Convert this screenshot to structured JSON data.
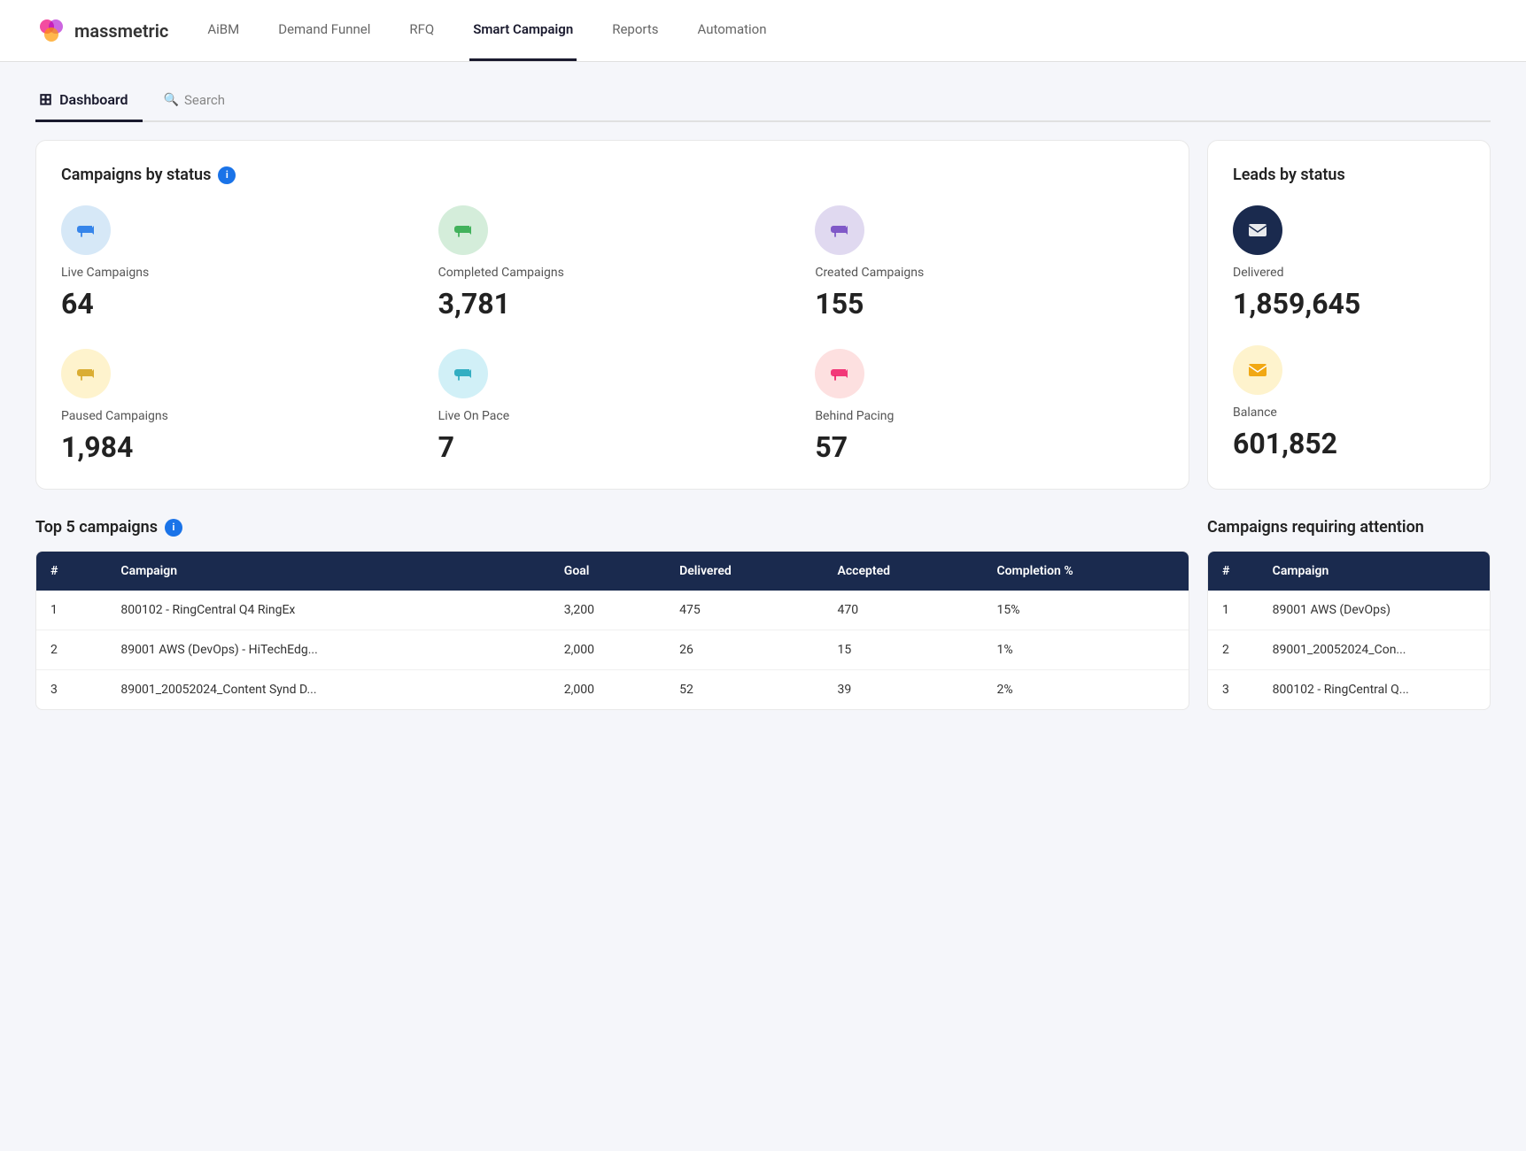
{
  "app": {
    "name": "massmetric"
  },
  "nav": {
    "items": [
      {
        "id": "aibm",
        "label": "AiBM",
        "active": false
      },
      {
        "id": "demand-funnel",
        "label": "Demand Funnel",
        "active": false
      },
      {
        "id": "rfq",
        "label": "RFQ",
        "active": false
      },
      {
        "id": "smart-campaign",
        "label": "Smart Campaign",
        "active": true
      },
      {
        "id": "reports",
        "label": "Reports",
        "active": false
      },
      {
        "id": "automation",
        "label": "Automation",
        "active": false
      }
    ]
  },
  "tabs": {
    "dashboard_label": "Dashboard",
    "search_label": "Search"
  },
  "campaigns_by_status": {
    "title": "Campaigns by status",
    "items": [
      {
        "id": "live-campaigns",
        "label": "Live Campaigns",
        "value": "64",
        "icon": "📣",
        "icon_class": "icon-blue-light"
      },
      {
        "id": "completed-campaigns",
        "label": "Completed Campaigns",
        "value": "3,781",
        "icon": "📣",
        "icon_class": "icon-green-light"
      },
      {
        "id": "created-campaigns",
        "label": "Created Campaigns",
        "value": "155",
        "icon": "📣",
        "icon_class": "icon-purple-light"
      },
      {
        "id": "paused-campaigns",
        "label": "Paused Campaigns",
        "value": "1,984",
        "icon": "📣",
        "icon_class": "icon-yellow-light"
      },
      {
        "id": "live-on-pace",
        "label": "Live On Pace",
        "value": "7",
        "icon": "📣",
        "icon_class": "icon-cyan-light"
      },
      {
        "id": "behind-pacing",
        "label": "Behind Pacing",
        "value": "57",
        "icon": "📣",
        "icon_class": "icon-pink-light"
      }
    ]
  },
  "leads_by_status": {
    "title": "Leads by status",
    "items": [
      {
        "id": "delivered",
        "label": "Delivered",
        "value": "1,859,645",
        "icon": "✉",
        "icon_class": "icon-dark-blue"
      },
      {
        "id": "balance",
        "label": "Balance",
        "value": "601,852",
        "icon": "✉",
        "icon_class": "icon-gold"
      }
    ]
  },
  "top5_campaigns": {
    "title": "Top 5 campaigns",
    "table": {
      "headers": [
        "#",
        "Campaign",
        "Goal",
        "Delivered",
        "Accepted",
        "Completion %"
      ],
      "rows": [
        {
          "num": "1",
          "campaign": "800102 - RingCentral Q4 RingEx",
          "goal": "3,200",
          "delivered": "475",
          "accepted": "470",
          "completion": "15%"
        },
        {
          "num": "2",
          "campaign": "89001 AWS (DevOps) - HiTechEdg...",
          "goal": "2,000",
          "delivered": "26",
          "accepted": "15",
          "completion": "1%"
        },
        {
          "num": "3",
          "campaign": "89001_20052024_Content Synd D...",
          "goal": "2,000",
          "delivered": "52",
          "accepted": "39",
          "completion": "2%"
        }
      ]
    }
  },
  "campaigns_requiring_attention": {
    "title": "Campaigns requiring attention",
    "table": {
      "headers": [
        "#",
        "Campaign"
      ],
      "rows": [
        {
          "num": "1",
          "campaign": "89001 AWS (DevOps)"
        },
        {
          "num": "2",
          "campaign": "89001_20052024_Con..."
        },
        {
          "num": "3",
          "campaign": "800102 - RingCentral Q..."
        }
      ]
    }
  },
  "colors": {
    "nav_active_border": "#1a1a2e",
    "table_header_bg": "#1a2a4e",
    "info_icon_bg": "#1a73e8"
  }
}
